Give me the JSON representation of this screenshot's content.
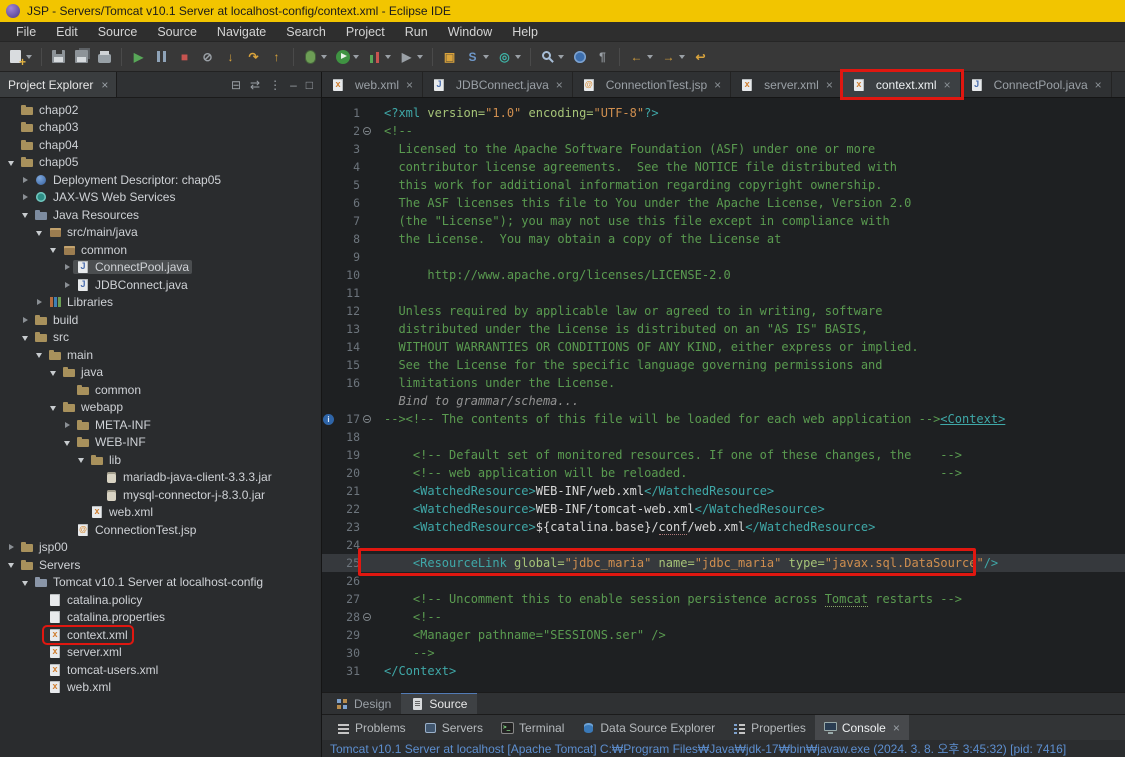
{
  "window": {
    "title": "JSP - Servers/Tomcat v10.1 Server at localhost-config/context.xml - Eclipse IDE"
  },
  "colors": {
    "accent_red": "#e01710",
    "titlebar": "#f2c500",
    "editor_bg": "#1e2022",
    "comment_green": "#5a9b50",
    "tag_teal": "#3fa8a8",
    "value_orange": "#cf8e4f"
  },
  "menu": {
    "items": [
      "File",
      "Edit",
      "Source",
      "Source",
      "Navigate",
      "Search",
      "Project",
      "Run",
      "Window",
      "Help"
    ]
  },
  "toolbar": {
    "items": [
      {
        "name": "new-wizard",
        "css": "i-new",
        "dd": true
      },
      {
        "sep": true
      },
      {
        "name": "save",
        "css": "i-save"
      },
      {
        "name": "save-all",
        "css": "i-saveall"
      },
      {
        "name": "print",
        "css": "i-print"
      },
      {
        "sep": true
      },
      {
        "name": "resume",
        "g": "▶",
        "cls": "col-green"
      },
      {
        "name": "suspend",
        "css": "i-pause"
      },
      {
        "name": "terminate",
        "g": "■",
        "cls": "col-red"
      },
      {
        "name": "disconnect",
        "g": "⊘",
        "cls": "col-gray"
      },
      {
        "name": "step-into",
        "g": "↓",
        "cls": "col-yellow"
      },
      {
        "name": "step-over",
        "g": "↷",
        "cls": "col-yellow"
      },
      {
        "name": "step-return",
        "g": "↑",
        "cls": "col-yellow"
      },
      {
        "sep": true
      },
      {
        "name": "debug",
        "css": "i-bug",
        "dd": true
      },
      {
        "name": "run",
        "css": "i-run",
        "dd": true
      },
      {
        "name": "coverage",
        "css": "i-cov",
        "dd": true
      },
      {
        "name": "external-tools",
        "g": "▶",
        "cls": "col-gray",
        "dd": true
      },
      {
        "sep": true
      },
      {
        "name": "new-java-project",
        "g": "▣",
        "cls": "col-yellow"
      },
      {
        "name": "create-servlet",
        "g": "S",
        "cls": "col-blue",
        "dd": true
      },
      {
        "name": "new-web-service",
        "g": "◎",
        "cls": "col-teal",
        "dd": true
      },
      {
        "sep": true
      },
      {
        "name": "search",
        "css": "i-search",
        "dd": true
      },
      {
        "name": "open-web-browser",
        "css": "i-globe"
      },
      {
        "name": "show-annotations",
        "g": "¶",
        "cls": "col-gray"
      },
      {
        "sep": true
      },
      {
        "name": "back",
        "g": "←",
        "cls": "col-yellow",
        "dd": true
      },
      {
        "name": "forward",
        "g": "→",
        "cls": "col-yellow",
        "dd": true
      },
      {
        "name": "last-edit-location",
        "g": "↩",
        "cls": "col-yellow"
      }
    ]
  },
  "project_explorer": {
    "title": "Project Explorer",
    "header_icons": [
      {
        "name": "collapse-all",
        "glyph": "⊟"
      },
      {
        "name": "link-with-editor",
        "glyph": "⇄"
      },
      {
        "name": "view-menu",
        "glyph": "⋮"
      },
      {
        "name": "minimize",
        "glyph": "–"
      },
      {
        "name": "maximize",
        "glyph": "□"
      }
    ],
    "tree": [
      {
        "d": 0,
        "a": -1,
        "i": "project",
        "l": "chap02"
      },
      {
        "d": 0,
        "a": -1,
        "i": "project",
        "l": "chap03"
      },
      {
        "d": 0,
        "a": -1,
        "i": "project",
        "l": "chap04"
      },
      {
        "d": 0,
        "a": 1,
        "i": "project",
        "l": "chap05"
      },
      {
        "d": 1,
        "a": 0,
        "i": "dd",
        "l": "Deployment Descriptor: chap05"
      },
      {
        "d": 1,
        "a": 0,
        "i": "ws",
        "l": "JAX-WS Web Services"
      },
      {
        "d": 1,
        "a": 1,
        "i": "javares",
        "l": "Java Resources"
      },
      {
        "d": 2,
        "a": 1,
        "i": "srcpkg",
        "l": "src/main/java"
      },
      {
        "d": 3,
        "a": 1,
        "i": "package",
        "l": "common"
      },
      {
        "d": 4,
        "a": 0,
        "i": "java",
        "l": "ConnectPool.java",
        "sel": true
      },
      {
        "d": 4,
        "a": 0,
        "i": "java",
        "l": "JDBConnect.java"
      },
      {
        "d": 2,
        "a": 0,
        "i": "lib",
        "l": "Libraries"
      },
      {
        "d": 1,
        "a": 0,
        "i": "folder",
        "l": "build"
      },
      {
        "d": 1,
        "a": 1,
        "i": "folder",
        "l": "src"
      },
      {
        "d": 2,
        "a": 1,
        "i": "folder",
        "l": "main"
      },
      {
        "d": 3,
        "a": 1,
        "i": "folder",
        "l": "java"
      },
      {
        "d": 4,
        "a": -1,
        "i": "folder",
        "l": "common"
      },
      {
        "d": 3,
        "a": 1,
        "i": "folder",
        "l": "webapp"
      },
      {
        "d": 4,
        "a": 0,
        "i": "folder",
        "l": "META-INF"
      },
      {
        "d": 4,
        "a": 1,
        "i": "folder",
        "l": "WEB-INF"
      },
      {
        "d": 5,
        "a": 1,
        "i": "folder",
        "l": "lib"
      },
      {
        "d": 6,
        "a": -1,
        "i": "jar",
        "l": "mariadb-java-client-3.3.3.jar"
      },
      {
        "d": 6,
        "a": -1,
        "i": "jar",
        "l": "mysql-connector-j-8.3.0.jar"
      },
      {
        "d": 5,
        "a": -1,
        "i": "xml",
        "l": "web.xml"
      },
      {
        "d": 4,
        "a": -1,
        "i": "jsp",
        "l": "ConnectionTest.jsp"
      },
      {
        "d": 0,
        "a": 0,
        "i": "project",
        "l": "jsp00"
      },
      {
        "d": 0,
        "a": 1,
        "i": "serverfolder",
        "l": "Servers"
      },
      {
        "d": 1,
        "a": 1,
        "i": "serverconf",
        "l": "Tomcat v10.1 Server at localhost-config"
      },
      {
        "d": 2,
        "a": -1,
        "i": "file",
        "l": "catalina.policy"
      },
      {
        "d": 2,
        "a": -1,
        "i": "file",
        "l": "catalina.properties"
      },
      {
        "d": 2,
        "a": -1,
        "i": "xml",
        "l": "context.xml",
        "boxed": true
      },
      {
        "d": 2,
        "a": -1,
        "i": "xml",
        "l": "server.xml"
      },
      {
        "d": 2,
        "a": -1,
        "i": "xml",
        "l": "tomcat-users.xml"
      },
      {
        "d": 2,
        "a": -1,
        "i": "xml",
        "l": "web.xml"
      }
    ]
  },
  "editor": {
    "tabs": [
      {
        "label": "web.xml",
        "icon": "xml",
        "close": true
      },
      {
        "label": "JDBConnect.java",
        "icon": "java",
        "close": true
      },
      {
        "label": "ConnectionTest.jsp",
        "icon": "jsp",
        "close": true
      },
      {
        "label": "server.xml",
        "icon": "xml",
        "close": true
      },
      {
        "label": "context.xml",
        "icon": "xml",
        "close": true,
        "active": true,
        "boxed": true
      },
      {
        "label": "ConnectPool.java",
        "icon": "java",
        "close": true
      }
    ],
    "lines": [
      {
        "n": 1,
        "s": [
          [
            "tag",
            "<?xml "
          ],
          [
            "attr",
            "version="
          ],
          [
            "val",
            "\"1.0\""
          ],
          [
            "attr",
            " encoding="
          ],
          [
            "val",
            "\"UTF-8\""
          ],
          [
            "tag",
            "?>"
          ]
        ]
      },
      {
        "n": 2,
        "fold": true,
        "s": [
          [
            "cmt",
            "<!--"
          ]
        ]
      },
      {
        "n": 3,
        "s": [
          [
            "cmt",
            "  Licensed to the Apache Software Foundation (ASF) under one or more"
          ]
        ]
      },
      {
        "n": 4,
        "s": [
          [
            "cmt",
            "  contributor license agreements.  See the NOTICE file distributed with"
          ]
        ]
      },
      {
        "n": 5,
        "s": [
          [
            "cmt",
            "  this work for additional information regarding copyright ownership."
          ]
        ]
      },
      {
        "n": 6,
        "s": [
          [
            "cmt",
            "  The ASF licenses this file to You under the Apache License, Version 2.0"
          ]
        ]
      },
      {
        "n": 7,
        "s": [
          [
            "cmt",
            "  (the \"License\"); you may not use this file except in compliance with"
          ]
        ]
      },
      {
        "n": 8,
        "s": [
          [
            "cmt",
            "  the License.  You may obtain a copy of the License at"
          ]
        ]
      },
      {
        "n": 9,
        "s": []
      },
      {
        "n": 10,
        "s": [
          [
            "cmt",
            "      http://www.apache.org/licenses/LICENSE-2.0"
          ]
        ]
      },
      {
        "n": 11,
        "s": []
      },
      {
        "n": 12,
        "s": [
          [
            "cmt",
            "  Unless required by applicable law or agreed to in writing, software"
          ]
        ]
      },
      {
        "n": 13,
        "s": [
          [
            "cmt",
            "  distributed under the License is distributed on an \"AS IS\" BASIS,"
          ]
        ]
      },
      {
        "n": 14,
        "s": [
          [
            "cmt",
            "  WITHOUT WARRANTIES OR CONDITIONS OF ANY KIND, either express or implied."
          ]
        ]
      },
      {
        "n": 15,
        "s": [
          [
            "cmt",
            "  See the License for the specific language governing permissions and"
          ]
        ]
      },
      {
        "n": 16,
        "s": [
          [
            "cmt",
            "  limitations under the License."
          ]
        ]
      },
      {
        "n": null,
        "s": [
          [
            "hint",
            "  Bind to grammar/schema..."
          ]
        ]
      },
      {
        "n": 17,
        "fold": true,
        "info": true,
        "s": [
          [
            "cmt",
            "--><!-- The contents of this file will be loaded for each web application -->"
          ],
          [
            "link",
            "<Context>"
          ]
        ]
      },
      {
        "n": 18,
        "s": []
      },
      {
        "n": 19,
        "s": [
          [
            "cmt",
            "    <!-- Default set of monitored resources. If one of these changes, the    -->"
          ]
        ]
      },
      {
        "n": 20,
        "s": [
          [
            "cmt",
            "    <!-- web application will be reloaded.                                   -->"
          ]
        ]
      },
      {
        "n": 21,
        "s": [
          [
            "tag",
            "    <WatchedResource>"
          ],
          [
            "txt",
            "WEB-INF/web.xml"
          ],
          [
            "tag",
            "</WatchedResource>"
          ]
        ]
      },
      {
        "n": 22,
        "s": [
          [
            "tag",
            "    <WatchedResource>"
          ],
          [
            "txt",
            "WEB-INF/tomcat-web.xml"
          ],
          [
            "tag",
            "</WatchedResource>"
          ]
        ]
      },
      {
        "n": 23,
        "s": [
          [
            "tag",
            "    <WatchedResource>"
          ],
          [
            "txt",
            "${catalina.base}/"
          ],
          [
            "misp",
            "conf"
          ],
          [
            "txt",
            "/web.xml"
          ],
          [
            "tag",
            "</WatchedResource>"
          ]
        ]
      },
      {
        "n": 24,
        "s": []
      },
      {
        "n": 25,
        "cur": true,
        "s": [
          [
            "tag",
            "    <ResourceLink "
          ],
          [
            "attr",
            "global="
          ],
          [
            "val",
            "\"jdbc_maria\""
          ],
          [
            "attr",
            " name="
          ],
          [
            "val",
            "\"jdbc_maria\""
          ],
          [
            "attr",
            " type="
          ],
          [
            "val",
            "\"javax.sql.DataSource\""
          ],
          [
            "tag",
            "/>"
          ]
        ]
      },
      {
        "n": 26,
        "s": []
      },
      {
        "n": 27,
        "s": [
          [
            "cmt",
            "    <!-- Uncomment this to enable session persistence across "
          ],
          [
            "cmtu",
            "Tomcat"
          ],
          [
            "cmt",
            " restarts -->"
          ]
        ]
      },
      {
        "n": 28,
        "fold": true,
        "s": [
          [
            "cmt",
            "    <!--"
          ]
        ]
      },
      {
        "n": 29,
        "s": [
          [
            "cmt",
            "    <Manager pathname=\"SESSIONS.ser\" />"
          ]
        ]
      },
      {
        "n": 30,
        "s": [
          [
            "cmt",
            "    -->"
          ]
        ]
      },
      {
        "n": 31,
        "s": [
          [
            "tag",
            "</Context>"
          ]
        ]
      }
    ]
  },
  "editor_subtabs": {
    "tabs": [
      {
        "label": "Design",
        "icon": "design"
      },
      {
        "label": "Source",
        "icon": "source",
        "active": true
      }
    ]
  },
  "bottom_panel": {
    "tabs": [
      {
        "label": "Problems",
        "icon": "problems"
      },
      {
        "label": "Servers",
        "icon": "servers"
      },
      {
        "label": "Terminal",
        "icon": "terminal"
      },
      {
        "label": "Data Source Explorer",
        "icon": "dse"
      },
      {
        "label": "Properties",
        "icon": "properties"
      },
      {
        "label": "Console",
        "icon": "console",
        "active": true,
        "close": true
      }
    ],
    "console_line": "Tomcat v10.1 Server at localhost [Apache Tomcat] C:₩Program Files₩Java₩jdk-17₩bin₩javaw.exe  (2024. 3. 8. 오후 3:45:32) [pid: 7416]"
  }
}
